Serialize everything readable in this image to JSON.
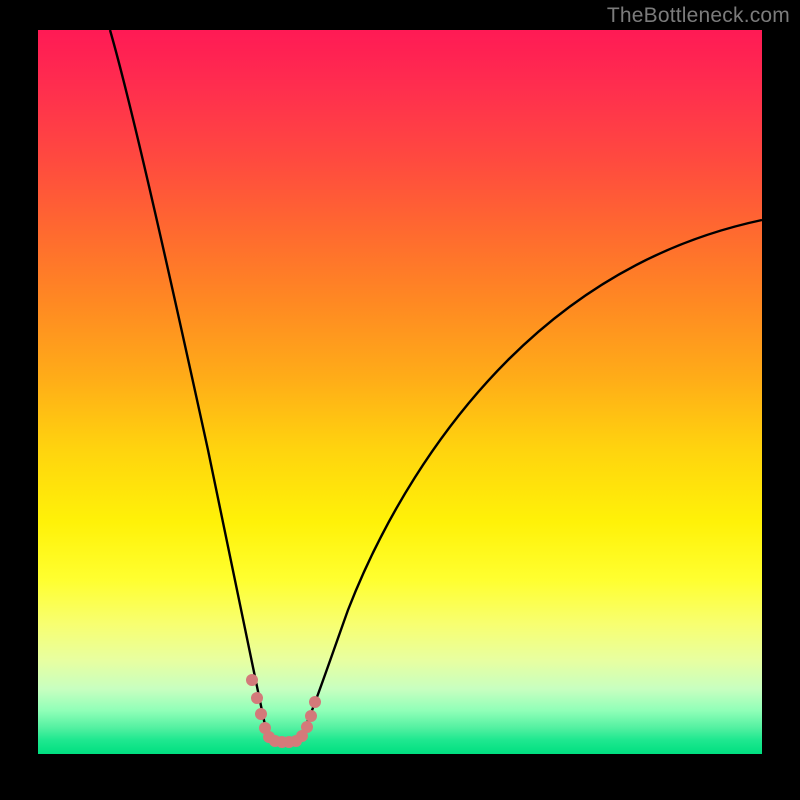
{
  "watermark": "TheBottleneck.com",
  "chart_data": {
    "type": "line",
    "title": "",
    "xlabel": "",
    "ylabel": "",
    "xlim": [
      0,
      100
    ],
    "ylim": [
      0,
      100
    ],
    "series": [
      {
        "name": "bottleneck-curve",
        "x_min_at": 32,
        "description": "V-shaped bottleneck percentage curve; left branch descends from ~100% at x≈10 to ~2% at x≈32; right branch rises from ~2% at x≈36 to ~70% at x≈100",
        "left_branch": [
          {
            "x": 10,
            "y": 100
          },
          {
            "x": 14,
            "y": 82
          },
          {
            "x": 18,
            "y": 62
          },
          {
            "x": 22,
            "y": 42
          },
          {
            "x": 26,
            "y": 24
          },
          {
            "x": 29,
            "y": 10
          },
          {
            "x": 31,
            "y": 3
          },
          {
            "x": 32,
            "y": 2
          }
        ],
        "right_branch": [
          {
            "x": 36,
            "y": 2
          },
          {
            "x": 38,
            "y": 5
          },
          {
            "x": 42,
            "y": 15
          },
          {
            "x": 48,
            "y": 28
          },
          {
            "x": 56,
            "y": 40
          },
          {
            "x": 66,
            "y": 50
          },
          {
            "x": 78,
            "y": 59
          },
          {
            "x": 90,
            "y": 66
          },
          {
            "x": 100,
            "y": 71
          }
        ]
      }
    ],
    "highlight_markers": {
      "color": "#d37a7a",
      "points": [
        {
          "x": 29.5,
          "y": 10
        },
        {
          "x": 30.2,
          "y": 7
        },
        {
          "x": 30.8,
          "y": 5
        },
        {
          "x": 31.3,
          "y": 3.5
        },
        {
          "x": 31.8,
          "y": 2.5
        },
        {
          "x": 32.5,
          "y": 2
        },
        {
          "x": 33.5,
          "y": 2
        },
        {
          "x": 34.5,
          "y": 2
        },
        {
          "x": 35.5,
          "y": 2
        },
        {
          "x": 36.3,
          "y": 2.5
        },
        {
          "x": 37.0,
          "y": 3.5
        },
        {
          "x": 37.6,
          "y": 5
        },
        {
          "x": 38.2,
          "y": 7
        }
      ]
    }
  }
}
